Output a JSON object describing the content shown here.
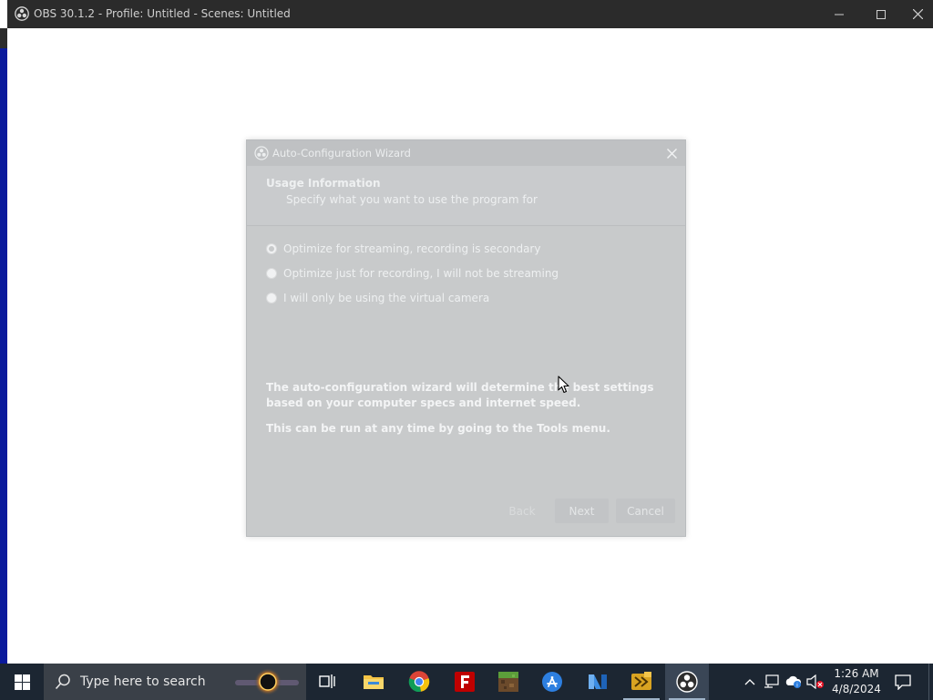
{
  "window": {
    "title": "OBS 30.1.2 - Profile: Untitled - Scenes: Untitled",
    "controls": {
      "minimize": "minimize-icon",
      "maximize": "maximize-icon",
      "close": "close-icon"
    }
  },
  "dialog": {
    "title": "Auto-Configuration Wizard",
    "header_title": "Usage Information",
    "header_subtitle": "Specify what you want to use the program for",
    "options": [
      {
        "label": "Optimize for streaming, recording is secondary",
        "selected": true
      },
      {
        "label": "Optimize just for recording, I will not be streaming",
        "selected": false
      },
      {
        "label": "I will only be using the virtual camera",
        "selected": false
      }
    ],
    "info_line1": "The auto-configuration wizard will determine the best settings based on your computer specs and internet speed.",
    "info_line2": "This can be run at any time by going to the Tools menu.",
    "buttons": {
      "back": "Back",
      "next": "Next",
      "cancel": "Cancel"
    }
  },
  "taskbar": {
    "search_placeholder": "Type here to search",
    "apps": [
      "task-view",
      "file-explorer",
      "chrome",
      "filezilla",
      "minecraft",
      "app-store",
      "visual-studio",
      "pinned-app",
      "obs-studio"
    ],
    "active_app": "obs-studio",
    "clock_time": "1:26 AM",
    "clock_date": "4/8/2024"
  },
  "colors": {
    "titlebar": "#2b2b2b",
    "taskbar": "#1c2632",
    "dialog_bg": "#c8cacb"
  }
}
